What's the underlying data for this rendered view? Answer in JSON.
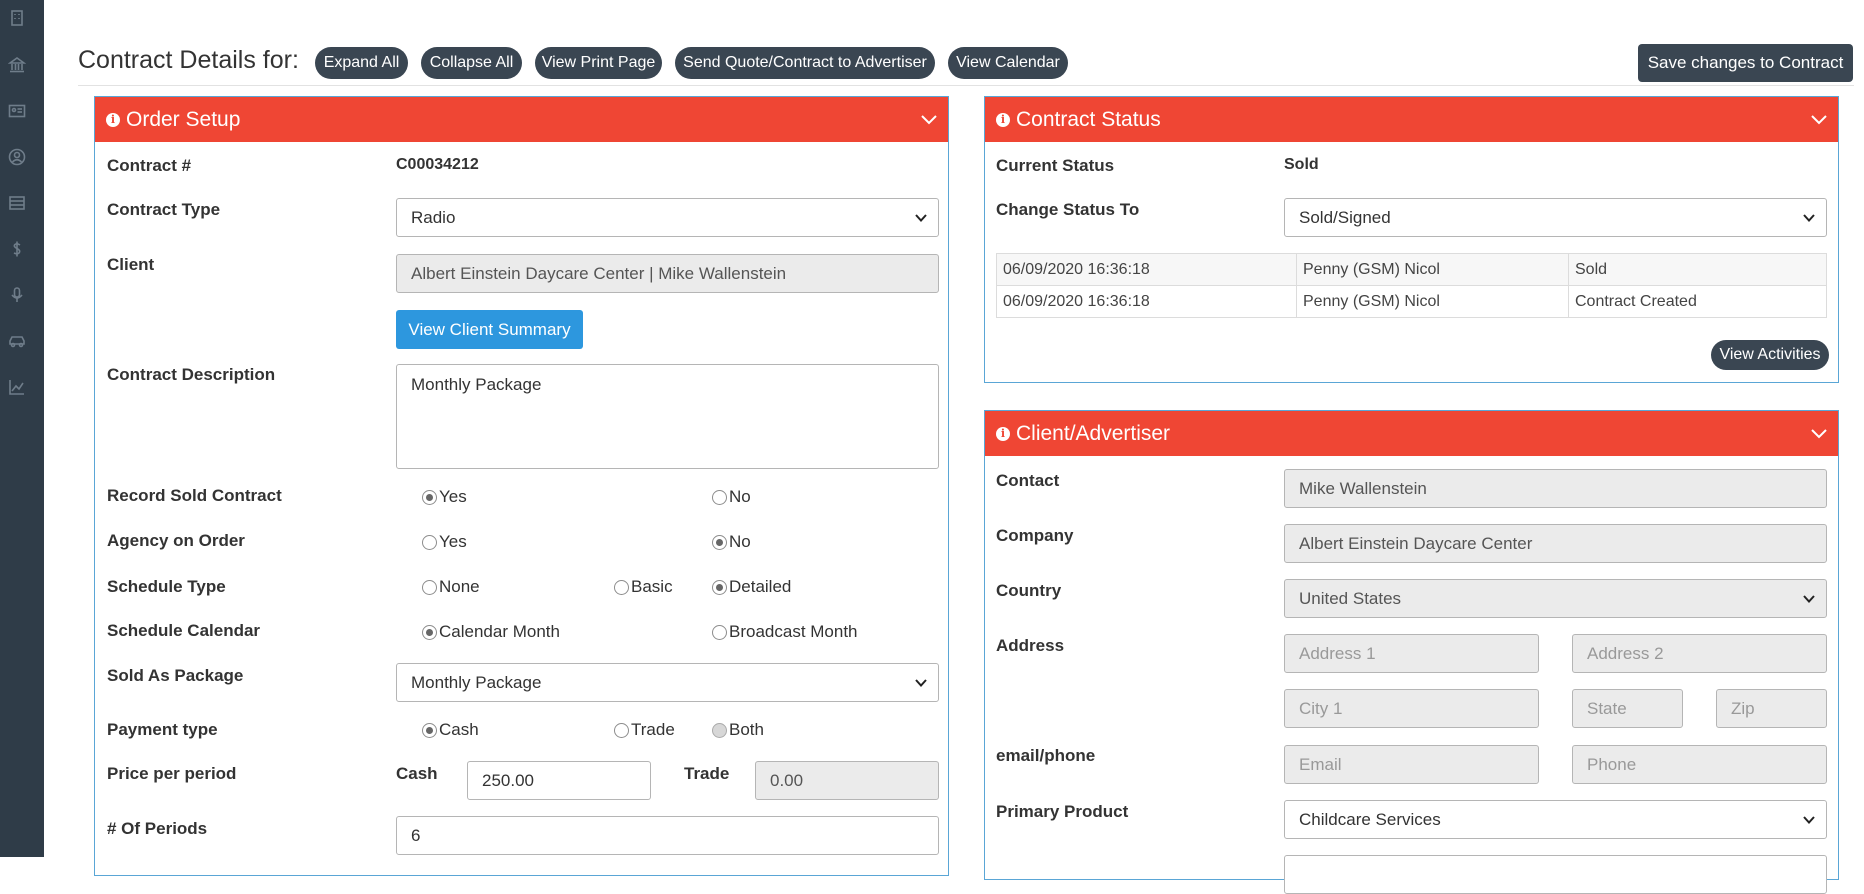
{
  "sidebar": {
    "icons": [
      "building-icon",
      "bank-icon",
      "id-card-icon",
      "user-circle-icon",
      "list-icon",
      "dollar-icon",
      "microphone-icon",
      "car-icon",
      "chart-line-icon"
    ]
  },
  "header": {
    "title": "Contract Details for:",
    "buttons": {
      "expand_all": "Expand All",
      "collapse_all": "Collapse All",
      "view_print_page": "View Print Page",
      "send_quote": "Send Quote/Contract to Advertiser",
      "view_calendar": "View Calendar"
    },
    "save_label": "Save changes to Contract"
  },
  "order_setup": {
    "title": "Order Setup",
    "contract_number_label": "Contract #",
    "contract_number": "C00034212",
    "contract_type_label": "Contract Type",
    "contract_type": "Radio",
    "client_label": "Client",
    "client": "Albert Einstein Daycare Center | Mike Wallenstein",
    "view_client_summary": "View Client Summary",
    "description_label": "Contract Description",
    "description": "Monthly Package",
    "record_sold_label": "Record Sold Contract",
    "record_sold_options": [
      "Yes",
      "No"
    ],
    "record_sold_selected": "Yes",
    "agency_label": "Agency on Order",
    "agency_options": [
      "Yes",
      "No"
    ],
    "agency_selected": "No",
    "schedule_type_label": "Schedule Type",
    "schedule_type_options": [
      "None",
      "Basic",
      "Detailed"
    ],
    "schedule_type_selected": "Detailed",
    "schedule_calendar_label": "Schedule Calendar",
    "schedule_calendar_options": [
      "Calendar Month",
      "Broadcast Month"
    ],
    "schedule_calendar_selected": "Calendar Month",
    "sold_as_package_label": "Sold As Package",
    "sold_as_package": "Monthly Package",
    "payment_type_label": "Payment type",
    "payment_type_options": [
      "Cash",
      "Trade",
      "Both"
    ],
    "payment_type_selected": "Cash",
    "price_label": "Price per period",
    "cash_label": "Cash",
    "cash_value": "250.00",
    "trade_label": "Trade",
    "trade_value": "0.00",
    "periods_label": "# Of Periods",
    "periods_value": "6"
  },
  "contract_status": {
    "title": "Contract Status",
    "current_status_label": "Current Status",
    "current_status": "Sold",
    "change_status_label": "Change Status To",
    "change_status": "Sold/Signed",
    "activities": [
      {
        "date": "06/09/2020 16:36:18",
        "user": "Penny (GSM) Nicol",
        "action": "Sold"
      },
      {
        "date": "06/09/2020 16:36:18",
        "user": "Penny (GSM) Nicol",
        "action": "Contract Created"
      }
    ],
    "view_activities": "View Activities"
  },
  "client_advertiser": {
    "title": "Client/Advertiser",
    "contact_label": "Contact",
    "contact": "Mike Wallenstein",
    "company_label": "Company",
    "company": "Albert Einstein Daycare Center",
    "country_label": "Country",
    "country": "United States",
    "address_label": "Address",
    "address1_placeholder": "Address 1",
    "address2_placeholder": "Address 2",
    "city_placeholder": "City 1",
    "state_placeholder": "State",
    "zip_placeholder": "Zip",
    "email_phone_label": "email/phone",
    "email_placeholder": "Email",
    "phone_placeholder": "Phone",
    "primary_product_label": "Primary Product",
    "primary_product": "Childcare Services"
  },
  "colors": {
    "sidebar": "#2f3c48",
    "panel_header": "#ef4634",
    "pill": "#3a4652",
    "primary_button": "#2d97de",
    "panel_border": "#5aa6d6"
  }
}
